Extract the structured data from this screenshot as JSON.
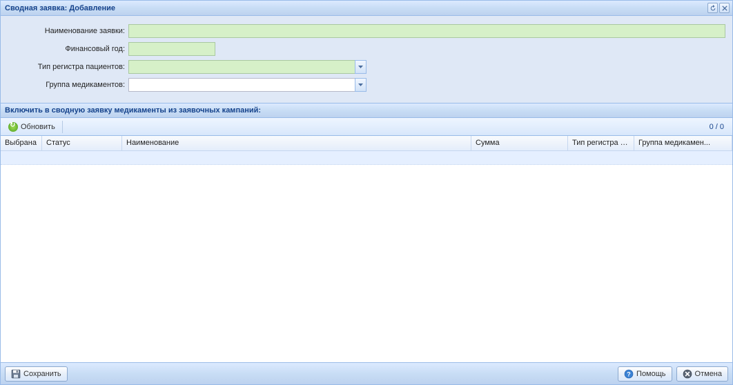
{
  "window": {
    "title": "Сводная заявка: Добавление"
  },
  "form": {
    "name_label": "Наименование заявки:",
    "year_label": "Финансовый год:",
    "registry_label": "Тип регистра пациентов:",
    "group_label": "Группа медикаментов:",
    "name_value": "",
    "year_value": "",
    "registry_value": "",
    "group_value": ""
  },
  "section": {
    "title": "Включить в сводную заявку медикаменты из заявочных кампаний:"
  },
  "toolbar": {
    "refresh_label": "Обновить",
    "count": "0 / 0"
  },
  "grid": {
    "columns": {
      "selected": "Выбрана",
      "status": "Статус",
      "name": "Наименование",
      "sum": "Сумма",
      "registry": "Тип регистра паци...",
      "group": "Группа медикамен..."
    }
  },
  "buttons": {
    "save": "Сохранить",
    "help": "Помощь",
    "cancel": "Отмена"
  }
}
